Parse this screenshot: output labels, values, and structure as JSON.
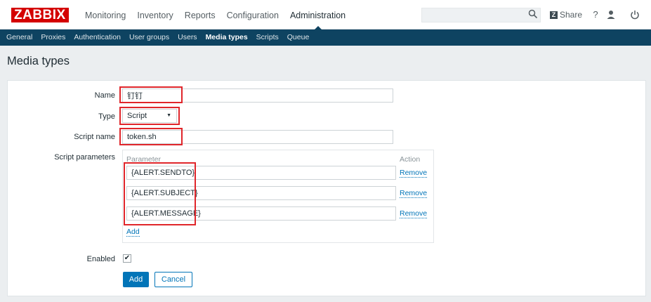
{
  "app": {
    "logo": "ZABBIX"
  },
  "top_menu": [
    {
      "label": "Monitoring"
    },
    {
      "label": "Inventory"
    },
    {
      "label": "Reports"
    },
    {
      "label": "Configuration"
    },
    {
      "label": "Administration",
      "active": true
    }
  ],
  "topbar": {
    "search_value": "",
    "share_label": "Share",
    "help_icon": "?",
    "user_icon": "user-icon",
    "logout_icon": "power-icon"
  },
  "sub_menu": [
    {
      "label": "General"
    },
    {
      "label": "Proxies"
    },
    {
      "label": "Authentication"
    },
    {
      "label": "User groups"
    },
    {
      "label": "Users"
    },
    {
      "label": "Media types",
      "active": true
    },
    {
      "label": "Scripts"
    },
    {
      "label": "Queue"
    }
  ],
  "page": {
    "title": "Media types"
  },
  "form": {
    "name_label": "Name",
    "name_value": "钉钉",
    "type_label": "Type",
    "type_value": "Script",
    "script_name_label": "Script name",
    "script_name_value": "token.sh",
    "script_params_label": "Script parameters",
    "param_col_header": "Parameter",
    "action_col_header": "Action",
    "parameters": [
      {
        "value": "{ALERT.SENDTO}",
        "action": "Remove"
      },
      {
        "value": "{ALERT.SUBJECT}",
        "action": "Remove"
      },
      {
        "value": "{ALERT.MESSAGE}",
        "action": "Remove"
      }
    ],
    "add_param_link": "Add",
    "enabled_label": "Enabled",
    "enabled_checked": true,
    "add_button": "Add",
    "cancel_button": "Cancel"
  },
  "colors": {
    "brand_red": "#d40000",
    "nav_blue": "#0e4361",
    "link_blue": "#0275b8",
    "highlight_red": "#e0262b"
  }
}
